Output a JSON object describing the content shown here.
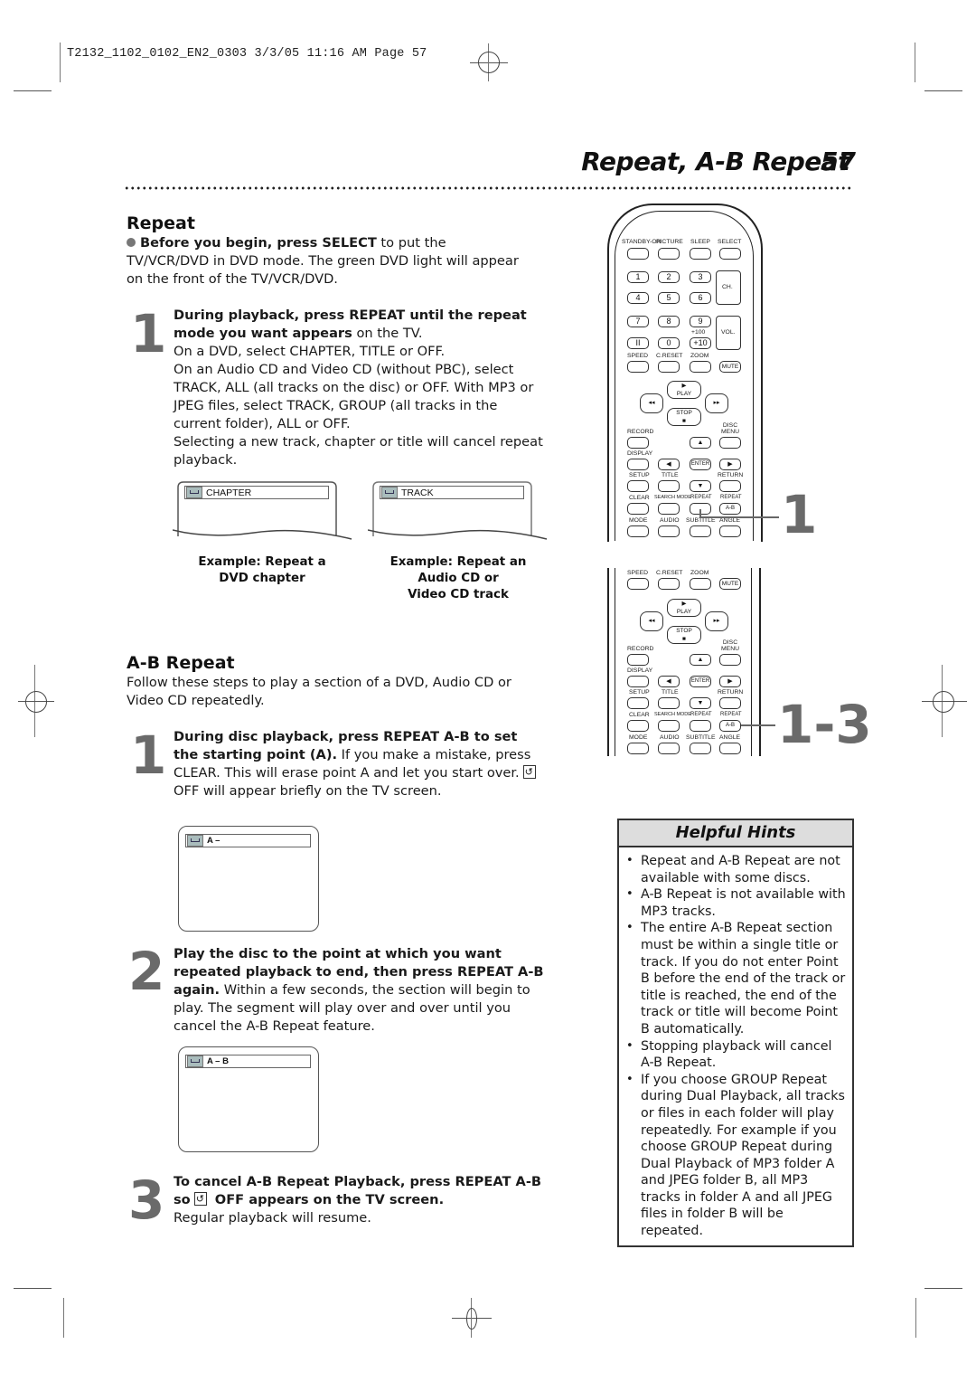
{
  "slug": "T2132_1102_0102_EN2_0303  3/3/05  11:16 AM  Page 57",
  "header": {
    "title": "Repeat,  A-B Repeat",
    "page_number": "57"
  },
  "repeat": {
    "heading": "Repeat",
    "intro_bold": "Before you begin, press SELECT",
    "intro_rest": " to put the TV/VCR/DVD in DVD mode. The green DVD light will appear on the front of the TV/VCR/DVD.",
    "step1": {
      "number": "1",
      "bold": "During playback, press REPEAT until the repeat mode you want appears",
      "rest": " on the TV.",
      "lines": [
        "On a DVD, select CHAPTER, TITLE or OFF.",
        "On an Audio CD and Video CD (without PBC), select TRACK, ALL (all tracks on the disc) or OFF. With MP3 or JPEG files, select TRACK, GROUP (all tracks in the current folder), ALL or OFF.",
        "Selecting a new track, chapter or title will cancel repeat playback."
      ]
    },
    "examples": [
      {
        "screen_text": "CHAPTER",
        "caption_line1": "Example: Repeat a",
        "caption_line2": "DVD chapter",
        "caption_line3": ""
      },
      {
        "screen_text": "TRACK",
        "caption_line1": "Example: Repeat an",
        "caption_line2": "Audio CD or",
        "caption_line3": "Video CD track"
      }
    ]
  },
  "ab_repeat": {
    "heading": "A-B Repeat",
    "intro": "Follow these steps to play a section of a DVD, Audio CD or Video CD repeatedly.",
    "step1": {
      "number": "1",
      "bold": "During disc playback, press REPEAT A-B to set the starting point (A).",
      "rest_a": " If you make a mistake, press CLEAR. This will erase point A and let you start over.",
      "rest_b": " OFF will appear briefly on the TV screen.",
      "screen_text": "A –"
    },
    "step2": {
      "number": "2",
      "bold": "Play the disc to the point at which you want repeated playback to end, then press REPEAT A-B again.",
      "rest": " Within a few seconds, the section will begin to play. The segment will play over and over until you cancel the A-B Repeat feature.",
      "screen_text": "A – B"
    },
    "step3": {
      "number": "3",
      "bold_a": "To cancel A-B Repeat Playback, press REPEAT A-B  so",
      "bold_b": " OFF appears on the TV screen.",
      "rest": "Regular playback will resume."
    }
  },
  "remote": {
    "top_labels": [
      "STANDBY-ON",
      "PICTURE",
      "SLEEP",
      "SELECT"
    ],
    "digits": [
      "1",
      "2",
      "3",
      "4",
      "5",
      "6",
      "7",
      "8",
      "9",
      "II",
      "0",
      "+10"
    ],
    "plus100": "+100",
    "ch": "CH.",
    "vol": "VOL.",
    "row_speed": [
      "SPEED",
      "C.RESET",
      "ZOOM"
    ],
    "mute": "MUTE",
    "play": "PLAY",
    "stop": "STOP",
    "record": "RECORD",
    "disc_menu_1": "DISC",
    "disc_menu_2": "MENU",
    "display": "DISPLAY",
    "enter": "ENTER",
    "setup": "SETUP",
    "title": "TITLE",
    "return": "RETURN",
    "row_clear": [
      "CLEAR",
      "SEARCH MODE",
      "REPEAT",
      "REPEAT"
    ],
    "ab": "A-B",
    "row_mode": [
      "MODE",
      "AUDIO",
      "SUBTITLE",
      "ANGLE"
    ],
    "callout_top": "1",
    "callout_bottom": "1-3"
  },
  "hints": {
    "title": "Helpful Hints",
    "items": [
      "Repeat and A-B Repeat are not available with some discs.",
      "A-B Repeat is not available with MP3 tracks.",
      "The entire A-B Repeat section must be within a single title or track. If you do not enter Point B before the end of the track or title is reached, the end of the track or title will become Point B automatically.",
      "Stopping playback will cancel A-B Repeat.",
      "If you choose GROUP Repeat during Dual Playback, all tracks or files in each folder will play repeatedly. For example if you choose GROUP Repeat during Dual Playback of MP3 folder A and JPEG folder B, all MP3 tracks in folder A and all JPEG files in folder B will be repeated."
    ]
  }
}
